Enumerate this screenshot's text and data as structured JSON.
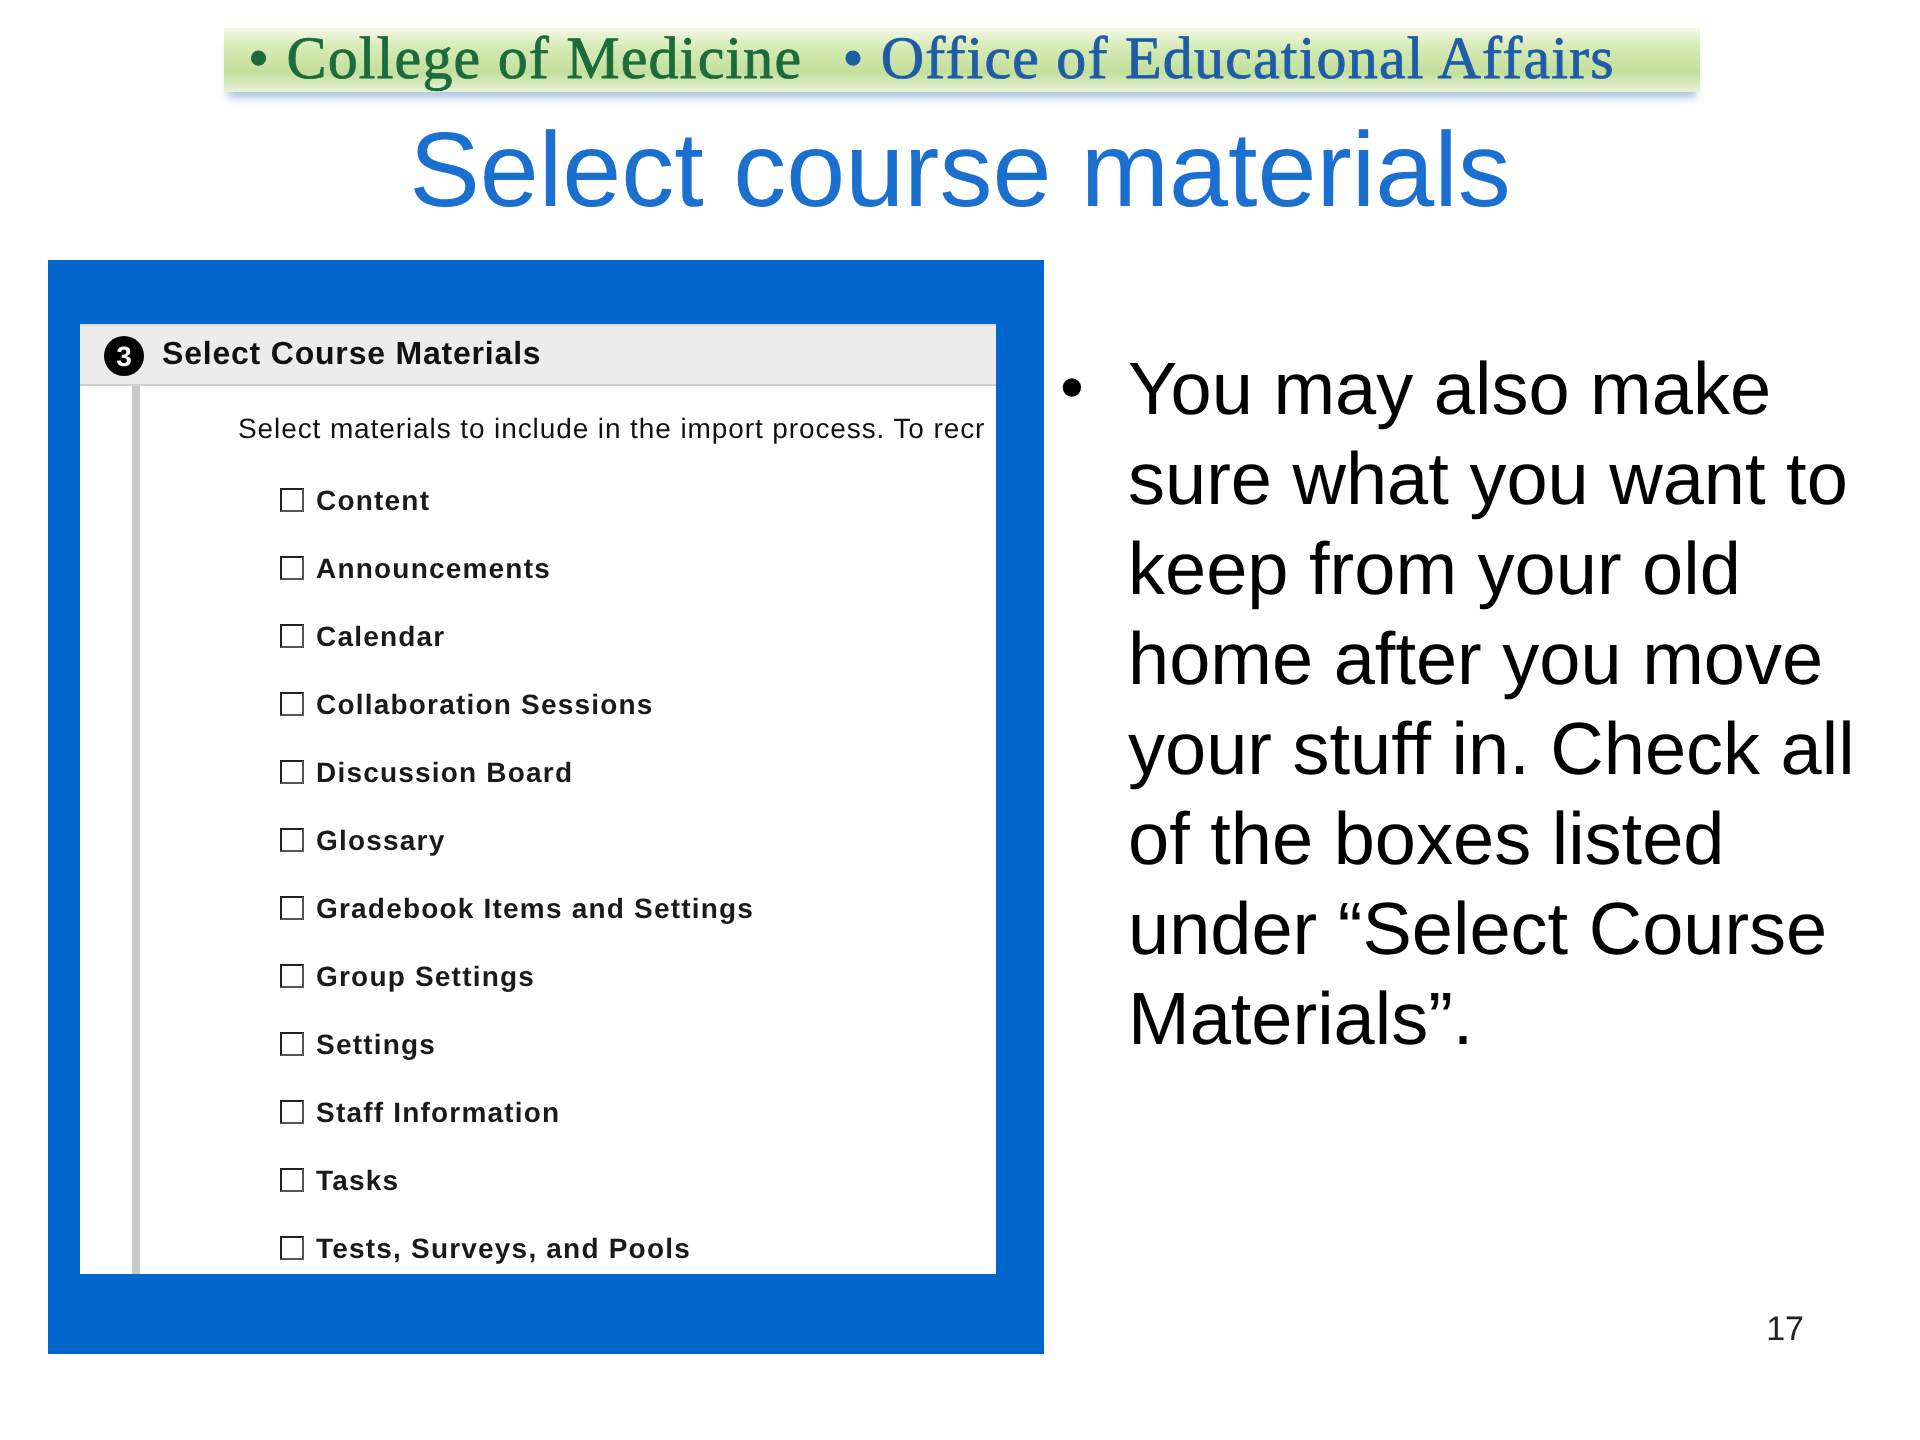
{
  "header": {
    "items": [
      {
        "text": "• College of Medicine",
        "color": "#1b6b3c"
      },
      {
        "text": "• Office of Educational Affairs",
        "color": "#1f5ca6"
      }
    ]
  },
  "title": "Select course materials",
  "screenshot": {
    "section": {
      "number": "3",
      "title": "Select Course Materials"
    },
    "instructions": "Select materials to include in the import process. To recr",
    "options": [
      {
        "label": "Content",
        "checked": false
      },
      {
        "label": "Announcements",
        "checked": false
      },
      {
        "label": "Calendar",
        "checked": false
      },
      {
        "label": "Collaboration Sessions",
        "checked": false
      },
      {
        "label": "Discussion Board",
        "checked": false
      },
      {
        "label": "Glossary",
        "checked": false
      },
      {
        "label": "Gradebook Items and Settings",
        "checked": false
      },
      {
        "label": "Group Settings",
        "checked": false
      },
      {
        "label": "Settings",
        "checked": false
      },
      {
        "label": "Staff Information",
        "checked": false
      },
      {
        "label": "Tasks",
        "checked": false
      },
      {
        "label": "Tests, Surveys, and Pools",
        "checked": false
      }
    ]
  },
  "bullets": [
    {
      "marker": "•",
      "text": "You may also make sure what you want to keep from your old home after you move your stuff in. Check all of the boxes listed under “Select Course Materials”."
    }
  ],
  "page_number": "17"
}
